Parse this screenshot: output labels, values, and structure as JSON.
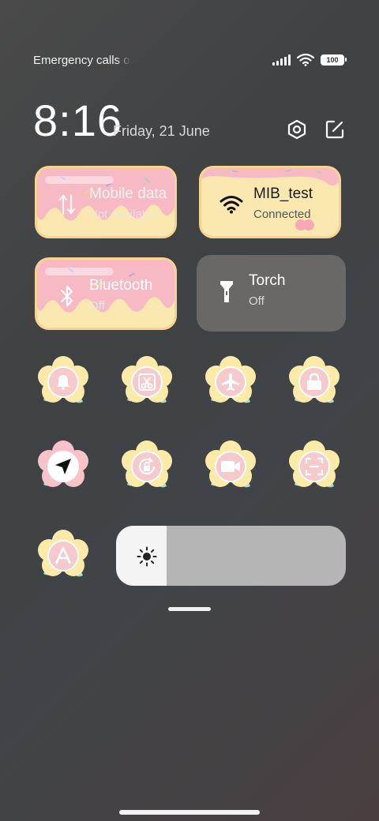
{
  "status_bar": {
    "left_text": "Emergency calls only",
    "battery": "100",
    "icons": [
      "signal-icon",
      "wifi-icon",
      "battery-icon"
    ]
  },
  "header": {
    "time": "8:16",
    "date": "Friday, 21 June",
    "icons": [
      "settings-icon",
      "edit-icon"
    ]
  },
  "tiles": [
    {
      "id": "mobile-data",
      "title": "Mobile data",
      "subtitle": "Not available",
      "icon": "mobile-data-icon",
      "style": "cake-pink"
    },
    {
      "id": "wifi",
      "title": "MIB_test",
      "subtitle": "Connected",
      "icon": "wifi-icon",
      "style": "cake-yellow"
    },
    {
      "id": "bluetooth",
      "title": "Bluetooth",
      "subtitle": "Off",
      "icon": "bluetooth-icon",
      "style": "cake-pink"
    },
    {
      "id": "torch",
      "title": "Torch",
      "subtitle": "Off",
      "icon": "flashlight-icon",
      "style": "gray"
    }
  ],
  "quick_toggles": [
    {
      "id": "sound",
      "icon": "bell-icon"
    },
    {
      "id": "screenshot",
      "icon": "scissors-icon"
    },
    {
      "id": "airplane-mode",
      "icon": "airplane-icon"
    },
    {
      "id": "lock-screen",
      "icon": "lock-icon"
    },
    {
      "id": "location",
      "icon": "navigation-arrow-icon"
    },
    {
      "id": "rotation-lock",
      "icon": "rotation-lock-icon"
    },
    {
      "id": "screen-recorder",
      "icon": "video-camera-icon"
    },
    {
      "id": "scanner",
      "icon": "scan-icon"
    },
    {
      "id": "font-size",
      "icon": "letter-a-icon"
    }
  ],
  "brightness": {
    "level": 0.22,
    "icon": "brightness-sun-icon"
  },
  "colors": {
    "cake_frosting_pink": "#f7b9c4",
    "cake_body_yellow": "#fbe8b0",
    "flower_core_pink": "#f6c9cc",
    "torch_tile": "#6a6866",
    "brightness_track": "#b5b5b5"
  }
}
